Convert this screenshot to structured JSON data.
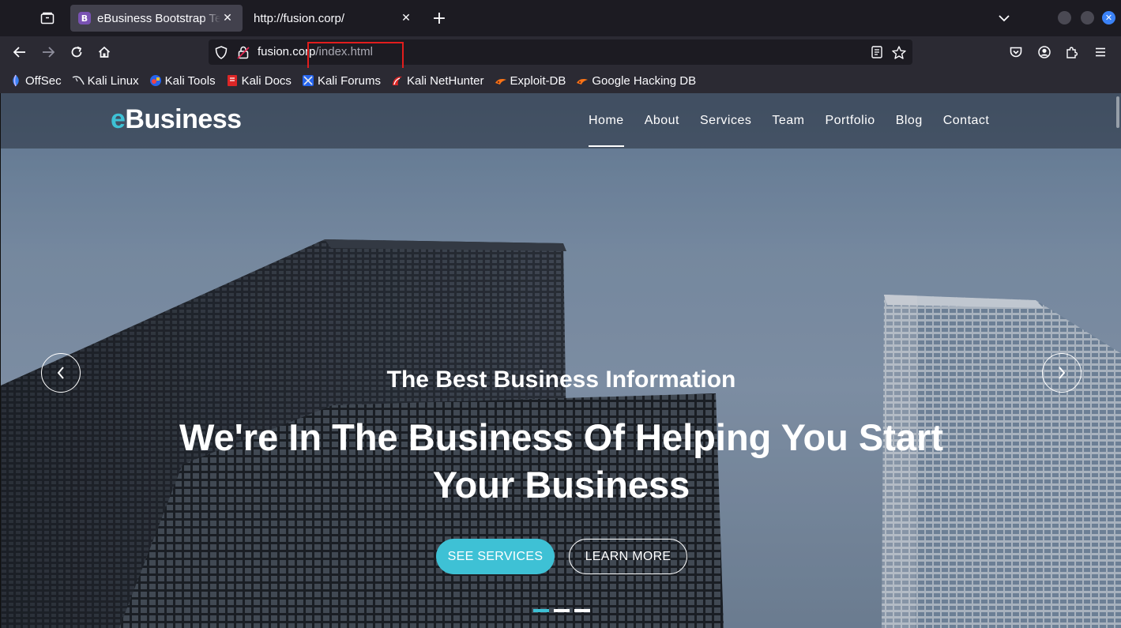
{
  "browser": {
    "tabs": [
      {
        "title": "eBusiness Bootstrap Template",
        "favicon": "B",
        "active": true
      },
      {
        "title": "http://fusion.corp/",
        "active": false
      }
    ],
    "url": {
      "host": "fusion.co",
      "host_tail": "rp",
      "path": "/index.html"
    },
    "bookmarks": [
      {
        "label": "OffSec",
        "icon": "offsec-icon"
      },
      {
        "label": "Kali Linux",
        "icon": "kali-dragon-icon"
      },
      {
        "label": "Kali Tools",
        "icon": "kali-tools-icon"
      },
      {
        "label": "Kali Docs",
        "icon": "kali-docs-icon"
      },
      {
        "label": "Kali Forums",
        "icon": "kali-forums-icon"
      },
      {
        "label": "Kali NetHunter",
        "icon": "nethunter-icon"
      },
      {
        "label": "Exploit-DB",
        "icon": "exploit-db-icon"
      },
      {
        "label": "Google Hacking DB",
        "icon": "ghdb-icon"
      }
    ],
    "colors": {
      "highlight_box": "#e11d1d",
      "window_close": "#3b82f6"
    }
  },
  "site": {
    "logo_accent": "e",
    "logo_rest": "Business",
    "nav": [
      "Home",
      "About",
      "Services",
      "Team",
      "Portfolio",
      "Blog",
      "Contact"
    ],
    "active_nav": "Home",
    "hero": {
      "subtitle": "The Best Business Information",
      "title": "We're In The Business Of Helping You Start Your Business",
      "primary_button": "SEE SERVICES",
      "secondary_button": "LEARN MORE"
    },
    "carousel": {
      "slides": 3,
      "active_slide": 1
    },
    "colors": {
      "accent": "#3ec1d5"
    }
  }
}
